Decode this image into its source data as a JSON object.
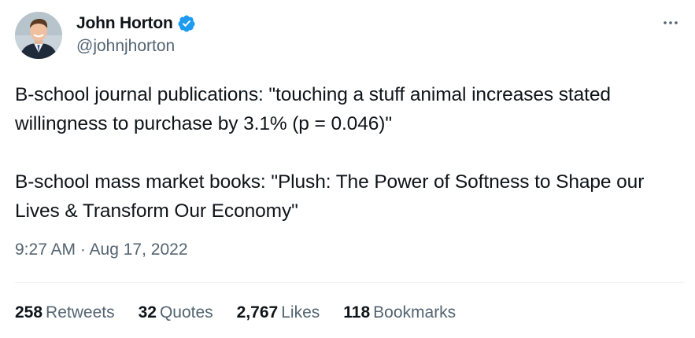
{
  "author": {
    "display_name": "John Horton",
    "handle": "@johnjhorton",
    "verified": true,
    "verified_color": "#1d9bf0"
  },
  "tweet": {
    "text": "B-school journal publications: \"touching a stuff animal increases stated willingness to purchase by 3.1% (p = 0.046)\"\n\nB-school mass market books: \"Plush: The Power of Softness to Shape our Lives & Transform Our Economy\"",
    "timestamp": "9:27 AM · Aug 17, 2022"
  },
  "stats": [
    {
      "count": "258",
      "label": "Retweets"
    },
    {
      "count": "32",
      "label": "Quotes"
    },
    {
      "count": "2,767",
      "label": "Likes"
    },
    {
      "count": "118",
      "label": "Bookmarks"
    }
  ],
  "icons": {
    "more": "more-horizontal-icon",
    "verified": "verified-badge-icon"
  },
  "colors": {
    "text_primary": "#0f1419",
    "text_secondary": "#536471",
    "divider": "#eff3f4"
  }
}
